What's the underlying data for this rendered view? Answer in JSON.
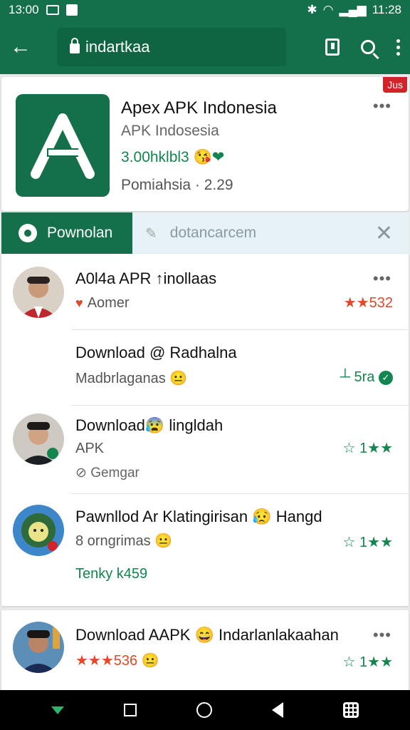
{
  "status_bar": {
    "time_left": "13:00",
    "time_right": "11:28"
  },
  "browser": {
    "url": "indartkaa"
  },
  "app_header": {
    "badge": "Jus",
    "title": "Apex APK Indonesia",
    "subtitle": "APK Indosesia",
    "price": "3.00hklbl3 😘❤",
    "meta": "Pomiahsia · 2.29"
  },
  "filter": {
    "chip_label": "Pownolan",
    "search_text": "dotancarcem"
  },
  "list": [
    {
      "title": "A0l4a APR ↑inollaas",
      "sub": "Aomer",
      "right": "★★532"
    },
    {
      "title": "Download @ Radhalna",
      "sub": "Madbrlaganas 😐",
      "right": "┴ 5ra"
    },
    {
      "title": "Download😰 lingldah",
      "sub": "APK",
      "sub2": "Gemgar",
      "right": "☆ 1★★"
    },
    {
      "title": "Pawnllod Ar Klatingirisan 😥 Hangd",
      "sub": "8 orngrimas 😐",
      "green": "Tenky k459",
      "right": "☆ 1★★"
    },
    {
      "title": "Download AAPK 😄 Indarlanlakaahan",
      "sub": "★★★536 😐",
      "right": "☆ 1★★"
    }
  ]
}
